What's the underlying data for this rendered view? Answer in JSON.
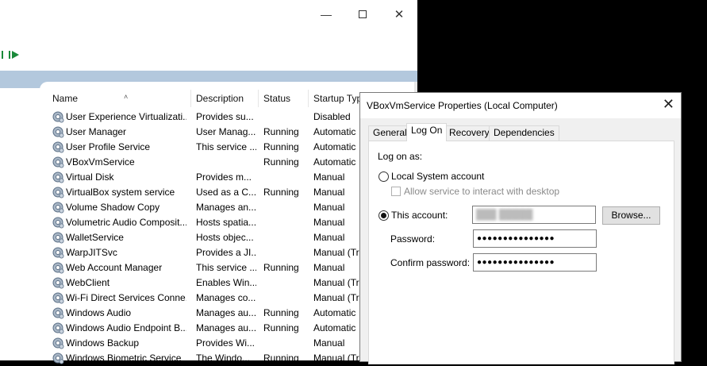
{
  "services": {
    "columns": {
      "name": "Name",
      "description": "Description",
      "status": "Status",
      "startup": "Startup Typ"
    },
    "rows": [
      {
        "name": "User Experience Virtualizati...",
        "description": "Provides su...",
        "status": "",
        "startup": "Disabled"
      },
      {
        "name": "User Manager",
        "description": "User Manag...",
        "status": "Running",
        "startup": "Automatic"
      },
      {
        "name": "User Profile Service",
        "description": "This service ...",
        "status": "Running",
        "startup": "Automatic"
      },
      {
        "name": "VBoxVmService",
        "description": "",
        "status": "Running",
        "startup": "Automatic"
      },
      {
        "name": "Virtual Disk",
        "description": "Provides m...",
        "status": "",
        "startup": "Manual"
      },
      {
        "name": "VirtualBox system service",
        "description": "Used as a C...",
        "status": "Running",
        "startup": "Manual"
      },
      {
        "name": "Volume Shadow Copy",
        "description": "Manages an...",
        "status": "",
        "startup": "Manual"
      },
      {
        "name": "Volumetric Audio Composit...",
        "description": "Hosts spatia...",
        "status": "",
        "startup": "Manual"
      },
      {
        "name": "WalletService",
        "description": "Hosts objec...",
        "status": "",
        "startup": "Manual"
      },
      {
        "name": "WarpJITSvc",
        "description": "Provides a JI...",
        "status": "",
        "startup": "Manual (Tri"
      },
      {
        "name": "Web Account Manager",
        "description": "This service ...",
        "status": "Running",
        "startup": "Manual"
      },
      {
        "name": "WebClient",
        "description": "Enables Win...",
        "status": "",
        "startup": "Manual (Tri"
      },
      {
        "name": "Wi-Fi Direct Services Conne...",
        "description": "Manages co...",
        "status": "",
        "startup": "Manual (Tri"
      },
      {
        "name": "Windows Audio",
        "description": "Manages au...",
        "status": "Running",
        "startup": "Automatic"
      },
      {
        "name": "Windows Audio Endpoint B...",
        "description": "Manages au...",
        "status": "Running",
        "startup": "Automatic"
      },
      {
        "name": "Windows Backup",
        "description": "Provides Wi...",
        "status": "",
        "startup": "Manual"
      },
      {
        "name": "Windows Biometric Service",
        "description": "The Windo...",
        "status": "Running",
        "startup": "Manual (Tri"
      }
    ]
  },
  "dialog": {
    "title": "VBoxVmService Properties (Local Computer)",
    "tabs": [
      "General",
      "Log On",
      "Recovery",
      "Dependencies"
    ],
    "logon_as": "Log on as:",
    "local_system": "Local System account",
    "allow_interact": "Allow service to interact with desktop",
    "this_account": "This account:",
    "account_value": "███ █████",
    "browse": "Browse...",
    "password_label": "Password:",
    "password_value": "●●●●●●●●●●●●●●●",
    "confirm_label": "Confirm password:",
    "confirm_value": "●●●●●●●●●●●●●●●"
  },
  "colors": {
    "pane_band": "#b3c8dd",
    "accent": "#0078d7"
  }
}
